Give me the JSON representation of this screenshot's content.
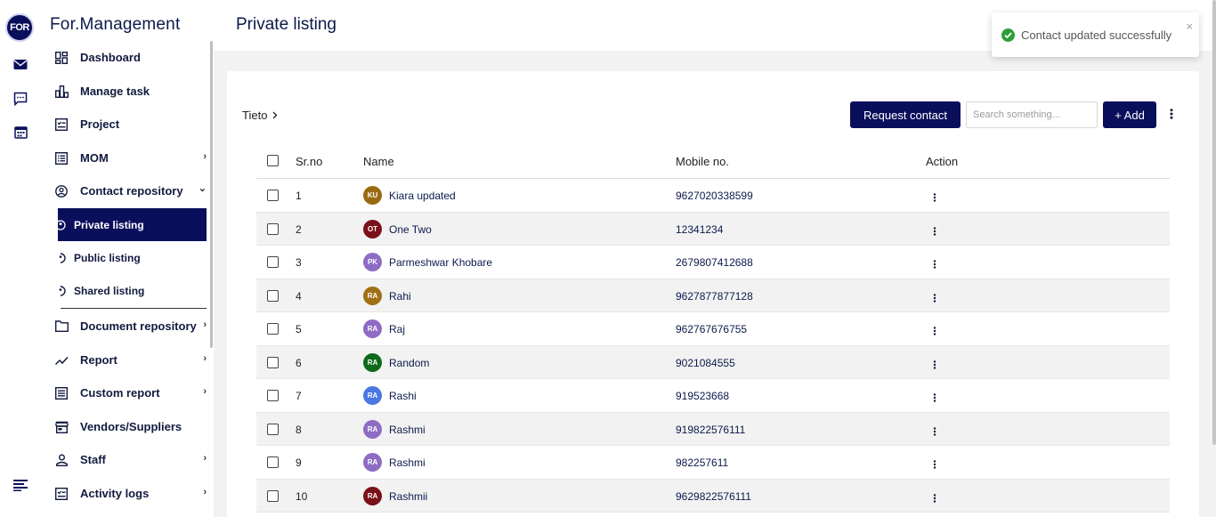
{
  "app": {
    "logo_text": "FOR",
    "brand": "For.Management"
  },
  "rail": {
    "icons": [
      "mail-icon",
      "chat-icon",
      "calendar-icon",
      "menu-icon"
    ]
  },
  "sidebar": {
    "items": [
      {
        "label": "Dashboard",
        "icon": "dashboard-icon"
      },
      {
        "label": "Manage task",
        "icon": "bar-chart-icon"
      },
      {
        "label": "Project",
        "icon": "project-icon"
      },
      {
        "label": "MOM",
        "icon": "list-icon",
        "chevron": "›"
      },
      {
        "label": "Contact repository",
        "icon": "contact-icon",
        "chevron": "⌄"
      },
      {
        "label": "Document repository",
        "icon": "folder-icon",
        "chevron": "›"
      },
      {
        "label": "Report",
        "icon": "trend-icon",
        "chevron": "›"
      },
      {
        "label": "Custom report",
        "icon": "report-icon",
        "chevron": "›"
      },
      {
        "label": "Vendors/Suppliers",
        "icon": "store-icon"
      },
      {
        "label": "Staff",
        "icon": "person-icon",
        "chevron": "›"
      },
      {
        "label": "Activity logs",
        "icon": "activity-icon",
        "chevron": "›"
      }
    ],
    "subitems": [
      {
        "label": "Private listing",
        "active": true
      },
      {
        "label": "Public listing"
      },
      {
        "label": "Shared listing"
      }
    ]
  },
  "header": {
    "title": "Private listing"
  },
  "toolbar": {
    "breadcrumb": "Tieto",
    "request_label": "Request contact",
    "search_placeholder": "Search something...",
    "add_label": "+ Add"
  },
  "table": {
    "headers": {
      "sr": "Sr.no",
      "name": "Name",
      "mobile": "Mobile no.",
      "action": "Action"
    },
    "rows": [
      {
        "sr": "1",
        "initials": "KU",
        "color": "#9a6a12",
        "name": "Kiara updated",
        "mobile": "9627020338599"
      },
      {
        "sr": "2",
        "initials": "OT",
        "color": "#7a1018",
        "name": "One Two",
        "mobile": "12341234"
      },
      {
        "sr": "3",
        "initials": "PK",
        "color": "#8e6cc4",
        "name": "Parmeshwar Khobare",
        "mobile": "2679807412688"
      },
      {
        "sr": "4",
        "initials": "RA",
        "color": "#a07014",
        "name": "Rahi",
        "mobile": "9627877877128"
      },
      {
        "sr": "5",
        "initials": "RA",
        "color": "#8e6cc4",
        "name": "Raj",
        "mobile": "962767676755"
      },
      {
        "sr": "6",
        "initials": "RA",
        "color": "#0e6a1a",
        "name": "Random",
        "mobile": "9021084555"
      },
      {
        "sr": "7",
        "initials": "RA",
        "color": "#4a78e0",
        "name": "Rashi",
        "mobile": "919523668"
      },
      {
        "sr": "8",
        "initials": "RA",
        "color": "#8e6cc4",
        "name": "Rashmi",
        "mobile": "919822576111"
      },
      {
        "sr": "9",
        "initials": "RA",
        "color": "#8e6cc4",
        "name": "Rashmi",
        "mobile": "982257611"
      },
      {
        "sr": "10",
        "initials": "RA",
        "color": "#7a1018",
        "name": "Rashmii",
        "mobile": "9629822576111"
      }
    ]
  },
  "toast": {
    "message": "Contact updated successfully",
    "close": "×"
  },
  "colors": {
    "primary": "#0a0f5c",
    "success": "#2e9d3a"
  }
}
